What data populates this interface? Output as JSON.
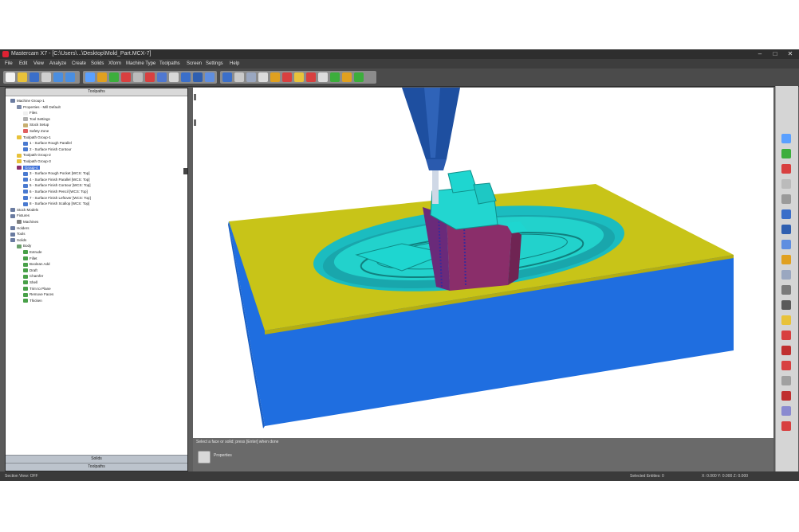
{
  "window": {
    "title": "Mastercam X7 - [C:\\Users\\...\\Desktop\\Mold_Part.MCX-7]",
    "minimize": "–",
    "maximize": "□",
    "close": "✕"
  },
  "menu": {
    "items": [
      "File",
      "Edit",
      "View",
      "Analyze",
      "Create",
      "Solids",
      "Xform",
      "Machine Type",
      "Toolpaths",
      "Screen",
      "Settings",
      "Help"
    ]
  },
  "toolbar": {
    "icons": [
      "new-file-icon",
      "open-folder-icon",
      "save-icon",
      "print-icon",
      "undo-icon",
      "redo-icon",
      "zoom-fit-icon",
      "zoom-window-icon",
      "zoom-in-icon",
      "zoom-out-icon",
      "rotate-icon",
      "pan-icon",
      "delete-icon",
      "analyze-icon",
      "top-view-icon",
      "front-view-icon",
      "right-view-icon",
      "iso-view-icon",
      "shade-icon",
      "wireframe-icon",
      "lathe-icon",
      "mill-icon",
      "contour-icon",
      "pocket-icon",
      "drill-icon",
      "surface-icon",
      "verify-icon",
      "backplot-icon",
      "post-icon"
    ]
  },
  "ops_manager": {
    "title": "Toolpaths",
    "tree": [
      {
        "label": "Machine Group-1",
        "indent": 0,
        "icon": "gear"
      },
      {
        "label": "Properties - Mill Default",
        "indent": 1,
        "icon": "props"
      },
      {
        "label": "Files",
        "indent": 2,
        "icon": "doc"
      },
      {
        "label": "Tool Settings",
        "indent": 2,
        "icon": "tool"
      },
      {
        "label": "Stock Setup",
        "indent": 2,
        "icon": "stock"
      },
      {
        "label": "Safety Zone",
        "indent": 2,
        "icon": "zone"
      },
      {
        "label": "Toolpath Group-1",
        "indent": 1,
        "icon": "folder"
      },
      {
        "label": "1 - Surface Rough Parallel",
        "indent": 2,
        "icon": "op"
      },
      {
        "label": "2 - Surface Finish Contour",
        "indent": 2,
        "icon": "op"
      },
      {
        "label": "Toolpath Group-2",
        "indent": 1,
        "icon": "folder"
      },
      {
        "label": "Toolpath Group-3",
        "indent": 1,
        "icon": "folder"
      },
      {
        "label": "Group-4",
        "indent": 1,
        "icon": "group-hl"
      },
      {
        "label": "3 - Surface Rough Pocket [WCS: Top]",
        "indent": 2,
        "icon": "op"
      },
      {
        "label": "4 - Surface Finish Parallel [WCS: Top]",
        "indent": 2,
        "icon": "op"
      },
      {
        "label": "5 - Surface Finish Contour [WCS: Top]",
        "indent": 2,
        "icon": "op"
      },
      {
        "label": "6 - Surface Finish Pencil [WCS: Top]",
        "indent": 2,
        "icon": "op"
      },
      {
        "label": "7 - Surface Finish Leftover [WCS: Top]",
        "indent": 2,
        "icon": "op"
      },
      {
        "label": "8 - Surface Finish Scallop [WCS: Top]",
        "indent": 2,
        "icon": "op"
      },
      {
        "label": "Stock Models",
        "indent": 0,
        "icon": "gear"
      },
      {
        "label": "Fixtures",
        "indent": 0,
        "icon": "gear"
      },
      {
        "label": "Machines",
        "indent": 1,
        "icon": "machine"
      },
      {
        "label": "Holders",
        "indent": 0,
        "icon": "gear"
      },
      {
        "label": "Tools",
        "indent": 0,
        "icon": "gear"
      },
      {
        "label": "Solids",
        "indent": 0,
        "icon": "gear"
      },
      {
        "label": "Body",
        "indent": 1,
        "icon": "solid"
      },
      {
        "label": "Extrude",
        "indent": 2,
        "icon": "solid-op"
      },
      {
        "label": "Fillet",
        "indent": 2,
        "icon": "solid-op"
      },
      {
        "label": "Boolean Add",
        "indent": 2,
        "icon": "solid-op"
      },
      {
        "label": "Draft",
        "indent": 2,
        "icon": "solid-op"
      },
      {
        "label": "Chamfer",
        "indent": 2,
        "icon": "solid-op"
      },
      {
        "label": "Shell",
        "indent": 2,
        "icon": "solid-op"
      },
      {
        "label": "Trim to Plane",
        "indent": 2,
        "icon": "solid-op"
      },
      {
        "label": "Remove Faces",
        "indent": 2,
        "icon": "solid-op"
      },
      {
        "label": "Thicken",
        "indent": 2,
        "icon": "solid-op"
      }
    ],
    "tabs": [
      "Solids",
      "Toolpaths"
    ]
  },
  "output": {
    "message": "Select a face or solid; press [Enter] when done",
    "properties_label": "Properties"
  },
  "status": {
    "left": "Section View: OFF",
    "middle": "Selected Entities: 0",
    "right": "X: 0.000   Y: 0.000   Z: 0.000"
  },
  "colors": {
    "stock_top": "#c8c418",
    "stock_side": "#1f6ee0",
    "part_cyan": "#1ed6d0",
    "part_maroon": "#8a2e6a",
    "spindle": "#1e4fa0"
  },
  "right_toolbar": {
    "icons": [
      "zoom-fit-icon",
      "zoom-in-icon",
      "zoom-out-icon",
      "rotate-icon",
      "pan-icon",
      "top-view-icon",
      "front-view-icon",
      "iso-view-icon",
      "shade-icon",
      "wireframe-icon",
      "cplane-icon",
      "wcs-icon",
      "level-icon",
      "line-icon",
      "arc-icon",
      "circle-icon",
      "point-icon",
      "spline-icon",
      "measure-icon",
      "line-icon-2"
    ]
  }
}
